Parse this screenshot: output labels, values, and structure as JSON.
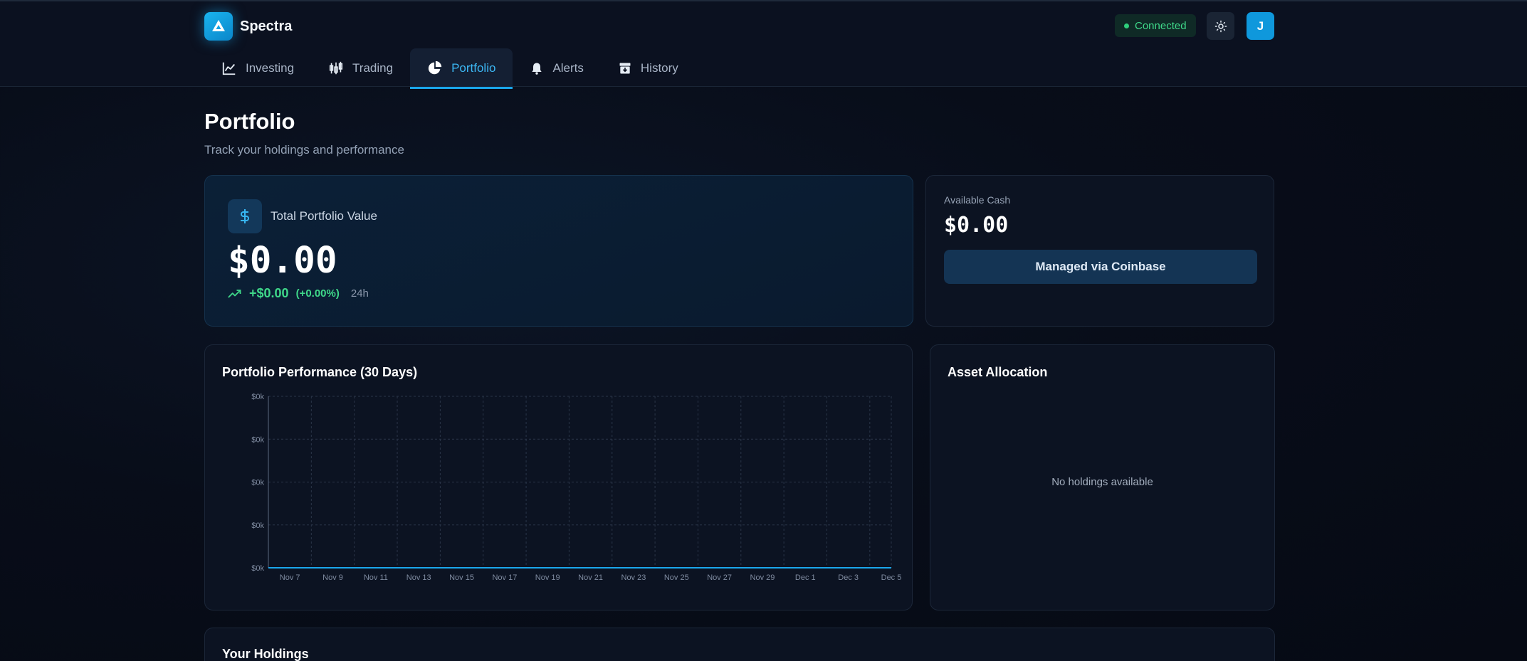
{
  "app": {
    "name": "Spectra",
    "status": "Connected",
    "avatar_initial": "J"
  },
  "nav": {
    "tabs": [
      {
        "label": "Investing",
        "icon": "line-chart-icon"
      },
      {
        "label": "Trading",
        "icon": "candlestick-icon"
      },
      {
        "label": "Portfolio",
        "icon": "pie-chart-icon",
        "active": true
      },
      {
        "label": "Alerts",
        "icon": "bell-icon"
      },
      {
        "label": "History",
        "icon": "archive-icon"
      }
    ]
  },
  "page": {
    "title": "Portfolio",
    "subtitle": "Track your holdings and performance"
  },
  "total": {
    "label": "Total Portfolio Value",
    "value": "$0.00",
    "change_abs": "+$0.00",
    "change_pct": "(+0.00%)",
    "period": "24h"
  },
  "cash": {
    "label": "Available Cash",
    "value": "$0.00",
    "button": "Managed via Coinbase"
  },
  "performance": {
    "title": "Portfolio Performance (30 Days)"
  },
  "allocation": {
    "title": "Asset Allocation",
    "empty": "No holdings available"
  },
  "holdings": {
    "title": "Your Holdings"
  },
  "colors": {
    "accent": "#1aa7ec",
    "positive": "#3fd98a",
    "background": "#080d19",
    "card": "#0c1322"
  },
  "chart_data": {
    "type": "line",
    "title": "Portfolio Performance (30 Days)",
    "x": [
      "Nov 7",
      "Nov 9",
      "Nov 11",
      "Nov 13",
      "Nov 15",
      "Nov 17",
      "Nov 19",
      "Nov 21",
      "Nov 23",
      "Nov 25",
      "Nov 27",
      "Nov 29",
      "Dec 1",
      "Dec 3",
      "Dec 5"
    ],
    "series": [
      {
        "values": [
          0,
          0,
          0,
          0,
          0,
          0,
          0,
          0,
          0,
          0,
          0,
          0,
          0,
          0,
          0
        ]
      }
    ],
    "y_ticks": [
      "$0k",
      "$0k",
      "$0k",
      "$0k",
      "$0k"
    ],
    "grid": true,
    "line_color": "#1aa7ec"
  }
}
